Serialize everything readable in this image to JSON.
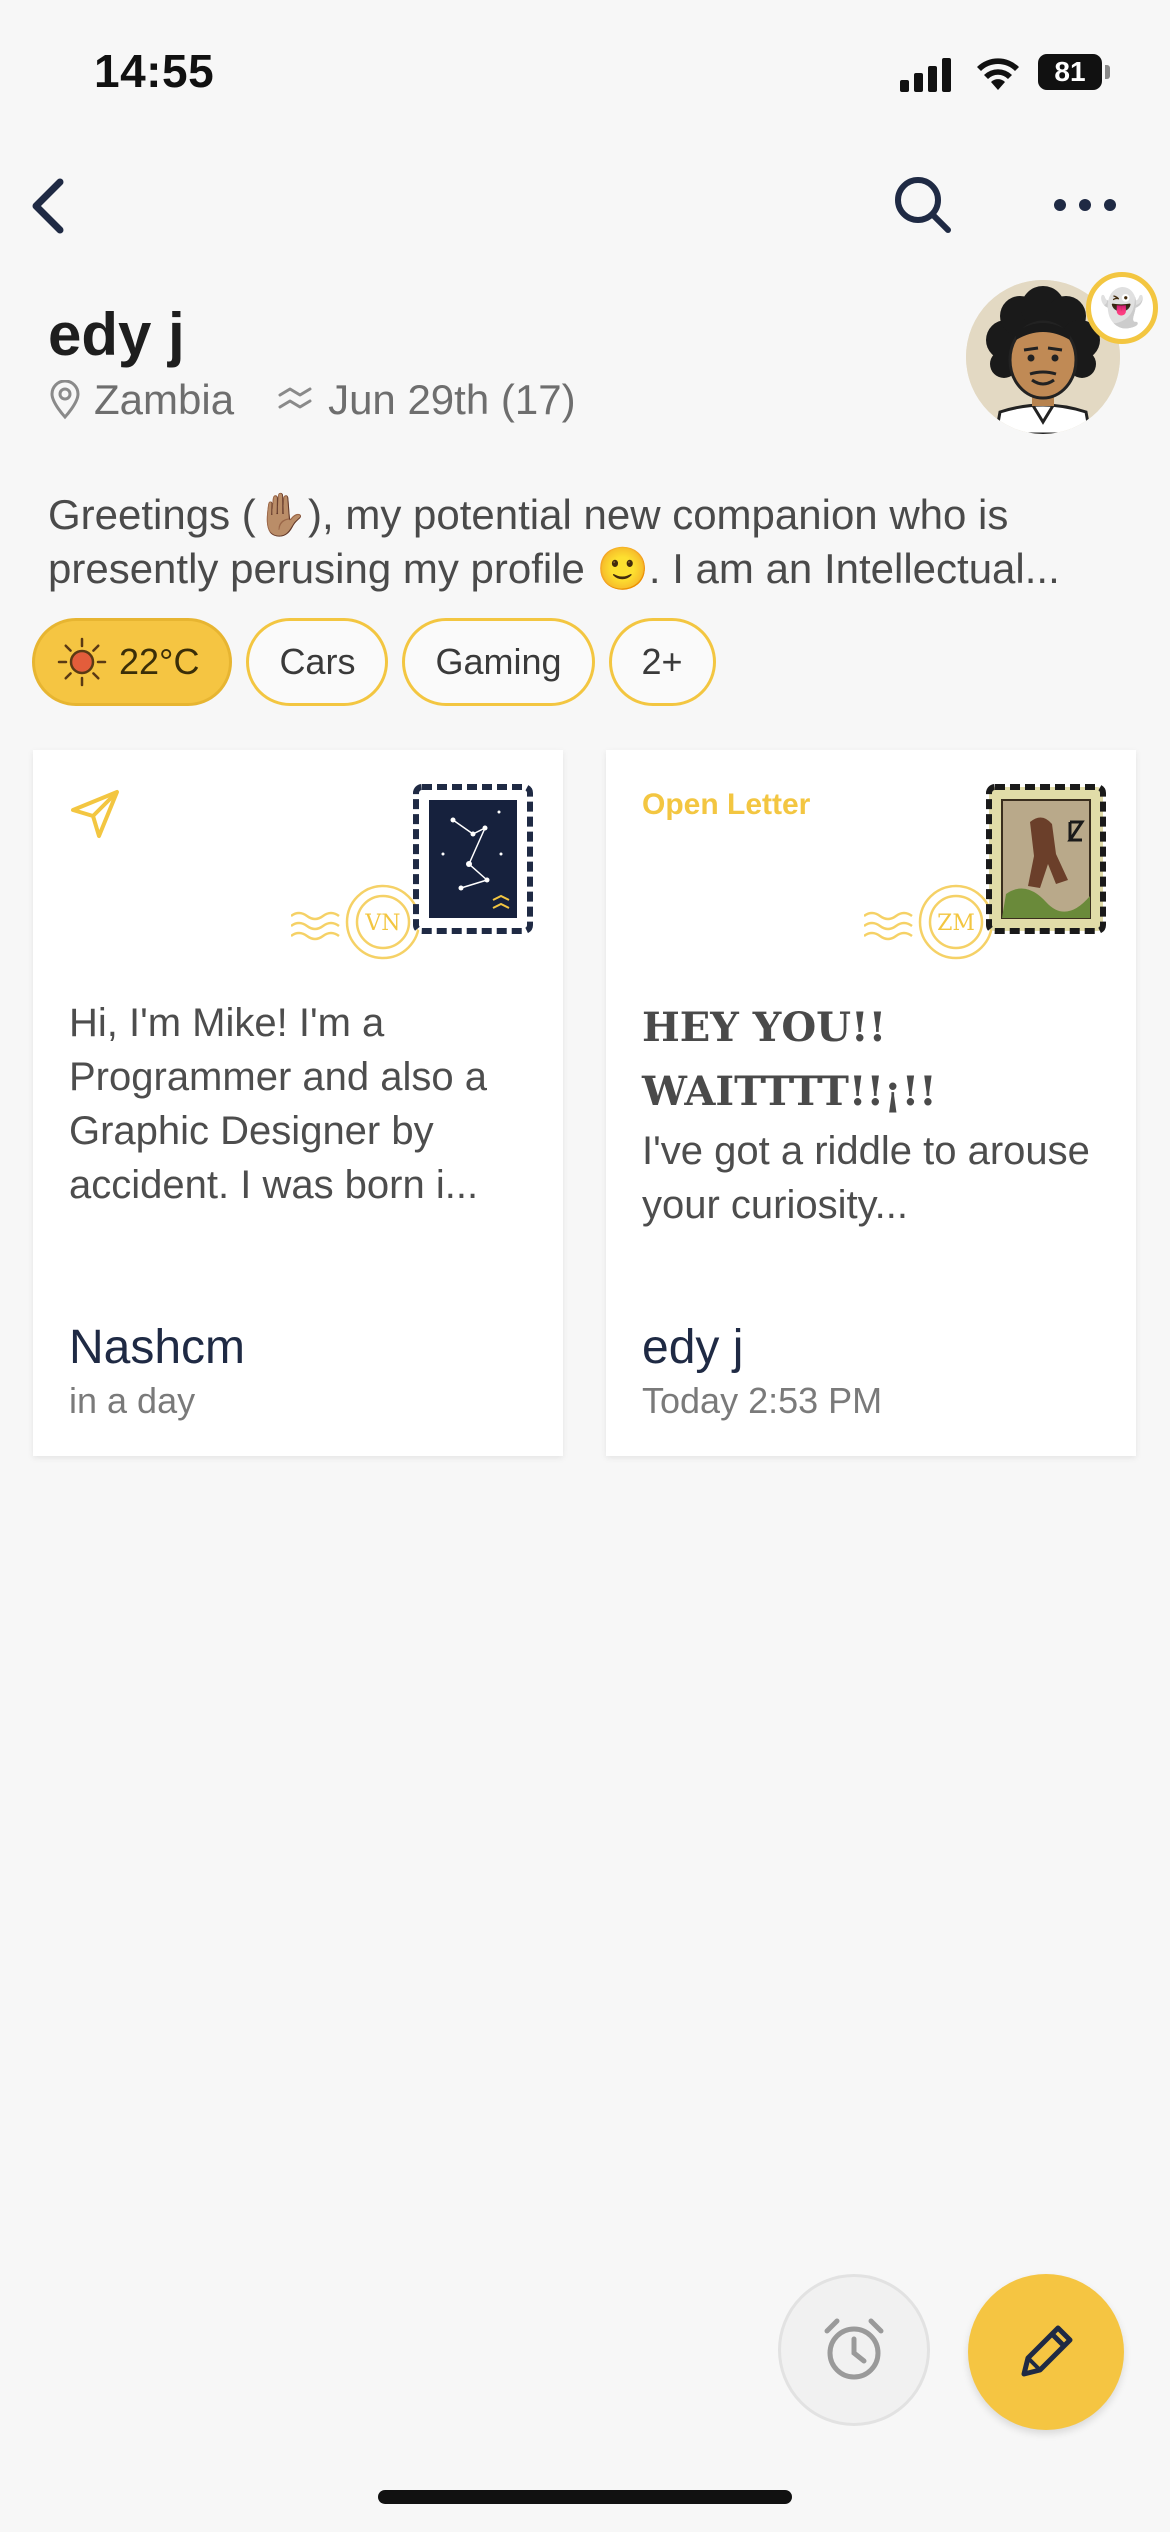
{
  "status_bar": {
    "time": "14:55",
    "battery": "81"
  },
  "nav": {
    "back_icon": "chevron-left-icon",
    "search_icon": "search-icon",
    "more_icon": "more-horizontal-icon"
  },
  "profile": {
    "name": "edy j",
    "location": "Zambia",
    "birthday": "Jun 29th (17)",
    "bio": "Greetings (✋🏽), my potential new companion who is presently perusing my profile 🙂. I am an Intellectual...",
    "badge_emoji": "👻"
  },
  "chips": {
    "weather": "22°C",
    "items": [
      "Cars",
      "Gaming",
      "2+"
    ]
  },
  "letters": [
    {
      "tag": "",
      "stamp_code": "VN",
      "text": "Hi, I'm Mike! I'm a Programmer and also a Graphic Designer by accident. I was born i...",
      "author": "Nashcm",
      "time": "in a day"
    },
    {
      "tag": "Open Letter",
      "stamp_code": "ZM",
      "headline": "HEY YOU!! WAITTTT!!¡!!",
      "text": "I've got a riddle to arouse your curiosity...",
      "author": "edy j",
      "time": "Today 2:53 PM"
    }
  ],
  "colors": {
    "accent": "#f5c542",
    "navy": "#1f2a44",
    "background": "#f7f7f7"
  }
}
